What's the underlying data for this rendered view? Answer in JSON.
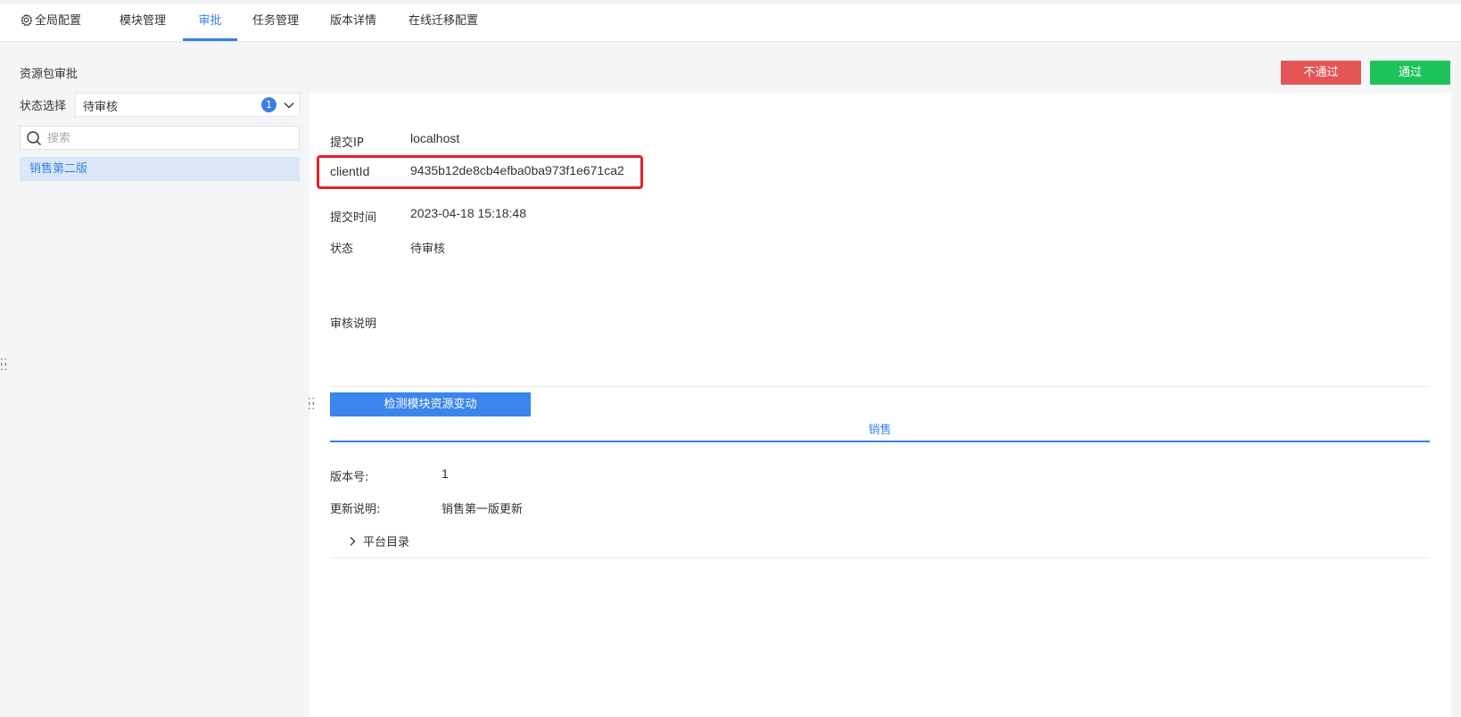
{
  "nav": {
    "tabs": [
      {
        "label": "全局配置"
      },
      {
        "label": "模块管理"
      },
      {
        "label": "审批"
      },
      {
        "label": "任务管理"
      },
      {
        "label": "版本详情"
      },
      {
        "label": "在线迁移配置"
      }
    ],
    "active_tab": "审批"
  },
  "page": {
    "section_label": "资源包审批",
    "reject_label": "不通过",
    "pass_label": "通过"
  },
  "sidebar": {
    "status_label": "状态选择",
    "status_value": "待审核",
    "status_count": "1",
    "search_placeholder": "搜索",
    "items": [
      {
        "label": "销售第二版"
      }
    ]
  },
  "detail": {
    "ip_label": "提交IP",
    "ip_value": "localhost",
    "client_label": "clientId",
    "client_value": "9435b12de8cb4efba0ba973f1e671ca2",
    "time_label": "提交时间",
    "time_value": "2023-04-18 15:18:48",
    "state_label": "状态",
    "state_value": "待审核",
    "review_label": "审核说明",
    "detect_button": "检测模块资源变动",
    "module_tab": "销售",
    "version_label": "版本号:",
    "version_value": "1",
    "update_label": "更新说明:",
    "update_value": "销售第一版更新",
    "tree_item": "平台目录"
  },
  "colors": {
    "accent": "#3a7fe6",
    "reject": "#e45555",
    "pass": "#1dc35a",
    "highlight": "#e8202a"
  }
}
